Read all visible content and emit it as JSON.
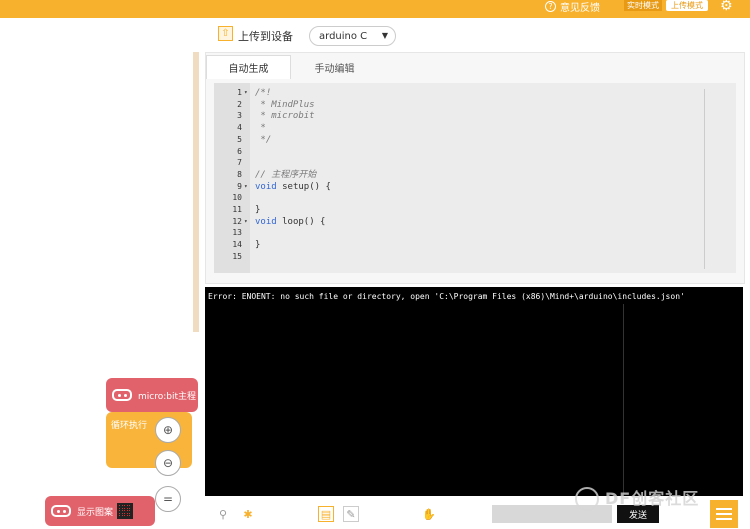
{
  "topbar": {
    "feedback_label": "意见反馈",
    "live_mode_label": "实时模式",
    "upload_mode_label": "上传模式"
  },
  "toolbar": {
    "upload_label": "上传到设备",
    "board_value": "arduino C"
  },
  "tabs": [
    {
      "label": "自动生成",
      "active": true
    },
    {
      "label": "手动编辑",
      "active": false
    }
  ],
  "code_lines": [
    {
      "n": "1",
      "fold": true,
      "text": "/*!",
      "kind": "cm"
    },
    {
      "n": "2",
      "fold": false,
      "text": " * MindPlus",
      "kind": "cm"
    },
    {
      "n": "3",
      "fold": false,
      "text": " * microbit",
      "kind": "cm"
    },
    {
      "n": "4",
      "fold": false,
      "text": " *",
      "kind": "cm"
    },
    {
      "n": "5",
      "fold": false,
      "text": " */",
      "kind": "cm"
    },
    {
      "n": "6",
      "fold": false,
      "text": "",
      "kind": "nm"
    },
    {
      "n": "7",
      "fold": false,
      "text": "",
      "kind": "nm"
    },
    {
      "n": "8",
      "fold": false,
      "text": "// 主程序开始",
      "kind": "cm"
    },
    {
      "n": "9",
      "fold": true,
      "text": "void setup() {",
      "kind": "fn"
    },
    {
      "n": "10",
      "fold": false,
      "text": "",
      "kind": "nm"
    },
    {
      "n": "11",
      "fold": false,
      "text": "}",
      "kind": "nm"
    },
    {
      "n": "12",
      "fold": true,
      "text": "void loop() {",
      "kind": "fn"
    },
    {
      "n": "13",
      "fold": false,
      "text": "",
      "kind": "nm"
    },
    {
      "n": "14",
      "fold": false,
      "text": "}",
      "kind": "nm"
    },
    {
      "n": "15",
      "fold": false,
      "text": "",
      "kind": "nm"
    }
  ],
  "console": {
    "message": "Error: ENOENT: no such file or directory, open 'C:\\Program Files (x86)\\Mind+\\arduino\\includes.json'"
  },
  "blocks": {
    "main_label": "micro:bit主程",
    "loop_label": "循环执行",
    "display_label": "显示图案"
  },
  "bottombar": {
    "send_label": "发送"
  },
  "watermark": "DF创客社区",
  "colors": {
    "accent": "#f8b12c",
    "block_red": "#e2626b",
    "block_orange": "#f9b53b"
  }
}
